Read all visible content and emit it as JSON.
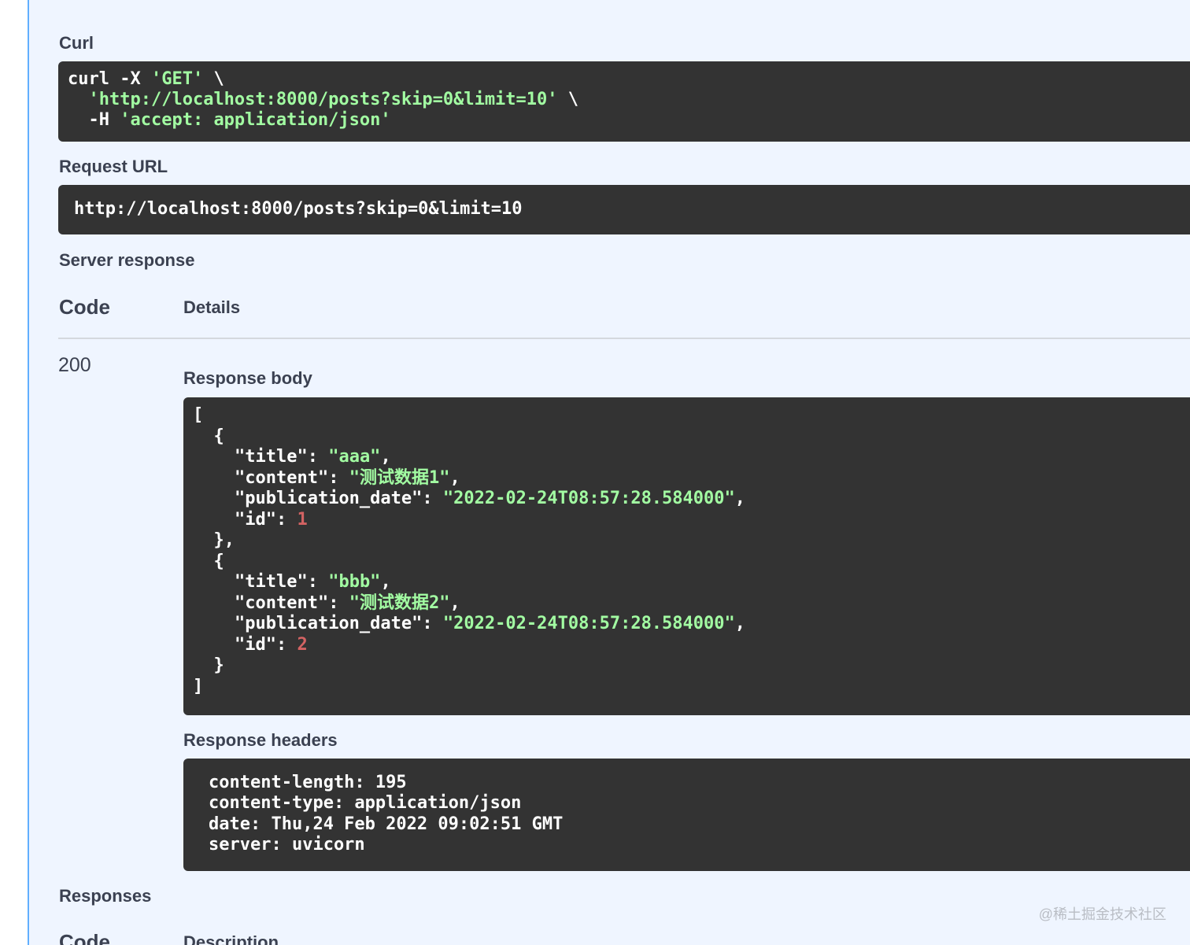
{
  "labels": {
    "curl": "Curl",
    "request_url": "Request URL",
    "server_response": "Server response",
    "response_body": "Response body",
    "response_headers": "Response headers",
    "responses": "Responses"
  },
  "curl": {
    "line1_cmd": "curl -X ",
    "line1_method": "'GET'",
    "line1_cont": " \\",
    "line2_indent": "  ",
    "line2_url": "'http://localhost:8000/posts?skip=0&limit=10'",
    "line2_cont": " \\",
    "line3_flag": "  -H ",
    "line3_header": "'accept: application/json'"
  },
  "request_url": "http://localhost:8000/posts?skip=0&limit=10",
  "table": {
    "code_header": "Code",
    "details_header": "Details",
    "status_code": "200",
    "bottom_code_header": "Code",
    "bottom_description_header": "Description"
  },
  "response_body": [
    {
      "title": "\"aaa\"",
      "content": "\"测试数据1\"",
      "publication_date": "\"2022-02-24T08:57:28.584000\"",
      "id": "1"
    },
    {
      "title": "\"bbb\"",
      "content": "\"测试数据2\"",
      "publication_date": "\"2022-02-24T08:57:28.584000\"",
      "id": "2"
    }
  ],
  "json_keys": {
    "title": "\"title\"",
    "content": "\"content\"",
    "publication_date": "\"publication_date\"",
    "id": "\"id\""
  },
  "response_headers": [
    "content-length: 195",
    "content-type: application/json",
    "date: Thu,24 Feb 2022 09:02:51 GMT",
    "server: uvicorn"
  ],
  "watermark": "@稀土掘金技术社区",
  "colors": {
    "panel_bg": "#eff5ff",
    "panel_border": "#61affe",
    "code_bg": "#333333",
    "string": "#a2fca2",
    "number": "#d36363",
    "text": "#3b4151"
  }
}
